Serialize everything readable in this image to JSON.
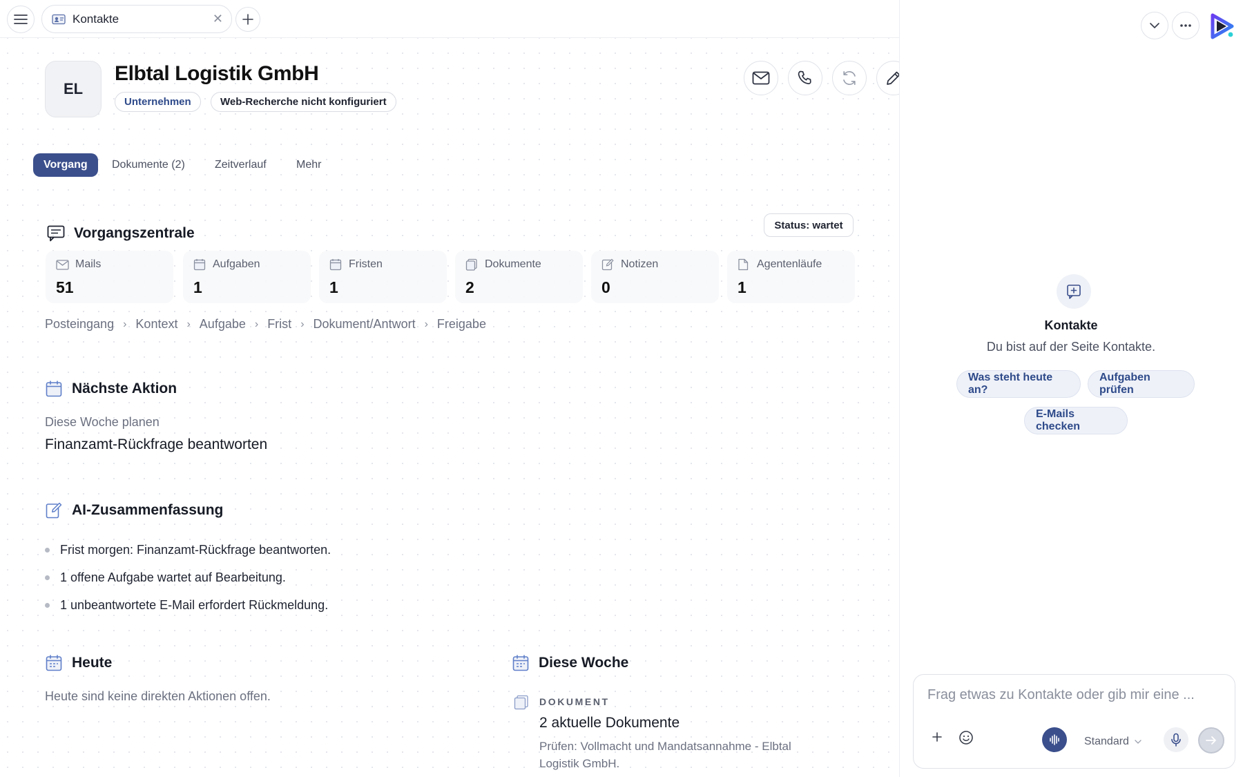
{
  "tabbar": {
    "tab_label": "Kontakte"
  },
  "header": {
    "avatar_initials": "EL",
    "title": "Elbtal Logistik GmbH",
    "badges": [
      "Unternehmen",
      "Web-Recherche nicht konfiguriert"
    ]
  },
  "nav": {
    "tabs": [
      {
        "label": "Vorgang",
        "active": true
      },
      {
        "label": "Dokumente (2)",
        "active": false
      },
      {
        "label": "Zeitverlauf",
        "active": false
      },
      {
        "label": "Mehr",
        "active": false
      }
    ]
  },
  "vorgang": {
    "title": "Vorgangszentrale",
    "status": "Status: wartet",
    "stats": [
      {
        "label": "Mails",
        "value": "51",
        "icon": "mail-icon"
      },
      {
        "label": "Aufgaben",
        "value": "1",
        "icon": "calendar-icon"
      },
      {
        "label": "Fristen",
        "value": "1",
        "icon": "calendar-icon"
      },
      {
        "label": "Dokumente",
        "value": "2",
        "icon": "document-icon"
      },
      {
        "label": "Notizen",
        "value": "0",
        "icon": "note-icon"
      },
      {
        "label": "Agentenläufe",
        "value": "1",
        "icon": "file-icon"
      }
    ],
    "breadcrumb": [
      "Posteingang",
      "Kontext",
      "Aufgabe",
      "Frist",
      "Dokument/Antwort",
      "Freigabe"
    ]
  },
  "next_action": {
    "title": "Nächste Aktion",
    "subtitle": "Diese Woche planen",
    "text": "Finanzamt-Rückfrage beantworten"
  },
  "summary": {
    "title": "AI-Zusammenfassung",
    "items": [
      "Frist morgen: Finanzamt-Rückfrage beantworten.",
      "1 offene Aufgabe wartet auf Bearbeitung.",
      "1 unbeantwortete E-Mail erfordert Rückmeldung."
    ]
  },
  "today": {
    "title": "Heute",
    "text": "Heute sind keine direkten Aktionen offen."
  },
  "week": {
    "title": "Diese Woche",
    "kicker": "DOKUMENT",
    "item_title": "2 aktuelle Dokumente",
    "item_desc": "Prüfen: Vollmacht und Mandatsannahme - Elbtal Logistik GmbH."
  },
  "assistant": {
    "context_title": "Kontakte",
    "context_sub": "Du bist auf der Seite Kontakte.",
    "suggestions": [
      "Was steht heute an?",
      "Aufgaben prüfen",
      "E-Mails checken"
    ],
    "placeholder": "Frag etwas zu Kontakte oder gib mir eine ...",
    "model": "Standard"
  },
  "colors": {
    "accent": "#3b4f8c",
    "chip_bg": "#eef1f8",
    "chip_text": "#2e4a8a"
  }
}
